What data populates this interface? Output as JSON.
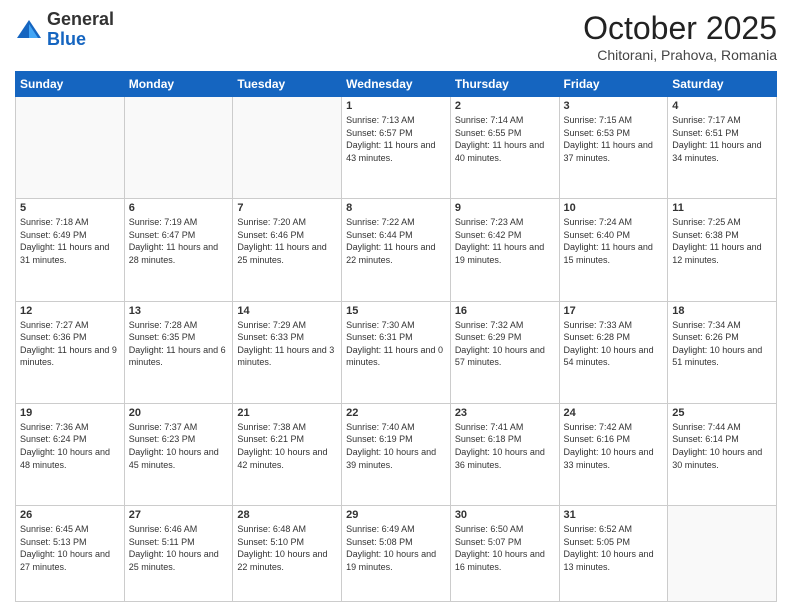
{
  "logo": {
    "general": "General",
    "blue": "Blue"
  },
  "header": {
    "month": "October 2025",
    "location": "Chitorani, Prahova, Romania"
  },
  "days_of_week": [
    "Sunday",
    "Monday",
    "Tuesday",
    "Wednesday",
    "Thursday",
    "Friday",
    "Saturday"
  ],
  "weeks": [
    [
      {
        "day": "",
        "info": ""
      },
      {
        "day": "",
        "info": ""
      },
      {
        "day": "",
        "info": ""
      },
      {
        "day": "1",
        "info": "Sunrise: 7:13 AM\nSunset: 6:57 PM\nDaylight: 11 hours and 43 minutes."
      },
      {
        "day": "2",
        "info": "Sunrise: 7:14 AM\nSunset: 6:55 PM\nDaylight: 11 hours and 40 minutes."
      },
      {
        "day": "3",
        "info": "Sunrise: 7:15 AM\nSunset: 6:53 PM\nDaylight: 11 hours and 37 minutes."
      },
      {
        "day": "4",
        "info": "Sunrise: 7:17 AM\nSunset: 6:51 PM\nDaylight: 11 hours and 34 minutes."
      }
    ],
    [
      {
        "day": "5",
        "info": "Sunrise: 7:18 AM\nSunset: 6:49 PM\nDaylight: 11 hours and 31 minutes."
      },
      {
        "day": "6",
        "info": "Sunrise: 7:19 AM\nSunset: 6:47 PM\nDaylight: 11 hours and 28 minutes."
      },
      {
        "day": "7",
        "info": "Sunrise: 7:20 AM\nSunset: 6:46 PM\nDaylight: 11 hours and 25 minutes."
      },
      {
        "day": "8",
        "info": "Sunrise: 7:22 AM\nSunset: 6:44 PM\nDaylight: 11 hours and 22 minutes."
      },
      {
        "day": "9",
        "info": "Sunrise: 7:23 AM\nSunset: 6:42 PM\nDaylight: 11 hours and 19 minutes."
      },
      {
        "day": "10",
        "info": "Sunrise: 7:24 AM\nSunset: 6:40 PM\nDaylight: 11 hours and 15 minutes."
      },
      {
        "day": "11",
        "info": "Sunrise: 7:25 AM\nSunset: 6:38 PM\nDaylight: 11 hours and 12 minutes."
      }
    ],
    [
      {
        "day": "12",
        "info": "Sunrise: 7:27 AM\nSunset: 6:36 PM\nDaylight: 11 hours and 9 minutes."
      },
      {
        "day": "13",
        "info": "Sunrise: 7:28 AM\nSunset: 6:35 PM\nDaylight: 11 hours and 6 minutes."
      },
      {
        "day": "14",
        "info": "Sunrise: 7:29 AM\nSunset: 6:33 PM\nDaylight: 11 hours and 3 minutes."
      },
      {
        "day": "15",
        "info": "Sunrise: 7:30 AM\nSunset: 6:31 PM\nDaylight: 11 hours and 0 minutes."
      },
      {
        "day": "16",
        "info": "Sunrise: 7:32 AM\nSunset: 6:29 PM\nDaylight: 10 hours and 57 minutes."
      },
      {
        "day": "17",
        "info": "Sunrise: 7:33 AM\nSunset: 6:28 PM\nDaylight: 10 hours and 54 minutes."
      },
      {
        "day": "18",
        "info": "Sunrise: 7:34 AM\nSunset: 6:26 PM\nDaylight: 10 hours and 51 minutes."
      }
    ],
    [
      {
        "day": "19",
        "info": "Sunrise: 7:36 AM\nSunset: 6:24 PM\nDaylight: 10 hours and 48 minutes."
      },
      {
        "day": "20",
        "info": "Sunrise: 7:37 AM\nSunset: 6:23 PM\nDaylight: 10 hours and 45 minutes."
      },
      {
        "day": "21",
        "info": "Sunrise: 7:38 AM\nSunset: 6:21 PM\nDaylight: 10 hours and 42 minutes."
      },
      {
        "day": "22",
        "info": "Sunrise: 7:40 AM\nSunset: 6:19 PM\nDaylight: 10 hours and 39 minutes."
      },
      {
        "day": "23",
        "info": "Sunrise: 7:41 AM\nSunset: 6:18 PM\nDaylight: 10 hours and 36 minutes."
      },
      {
        "day": "24",
        "info": "Sunrise: 7:42 AM\nSunset: 6:16 PM\nDaylight: 10 hours and 33 minutes."
      },
      {
        "day": "25",
        "info": "Sunrise: 7:44 AM\nSunset: 6:14 PM\nDaylight: 10 hours and 30 minutes."
      }
    ],
    [
      {
        "day": "26",
        "info": "Sunrise: 6:45 AM\nSunset: 5:13 PM\nDaylight: 10 hours and 27 minutes."
      },
      {
        "day": "27",
        "info": "Sunrise: 6:46 AM\nSunset: 5:11 PM\nDaylight: 10 hours and 25 minutes."
      },
      {
        "day": "28",
        "info": "Sunrise: 6:48 AM\nSunset: 5:10 PM\nDaylight: 10 hours and 22 minutes."
      },
      {
        "day": "29",
        "info": "Sunrise: 6:49 AM\nSunset: 5:08 PM\nDaylight: 10 hours and 19 minutes."
      },
      {
        "day": "30",
        "info": "Sunrise: 6:50 AM\nSunset: 5:07 PM\nDaylight: 10 hours and 16 minutes."
      },
      {
        "day": "31",
        "info": "Sunrise: 6:52 AM\nSunset: 5:05 PM\nDaylight: 10 hours and 13 minutes."
      },
      {
        "day": "",
        "info": ""
      }
    ]
  ]
}
